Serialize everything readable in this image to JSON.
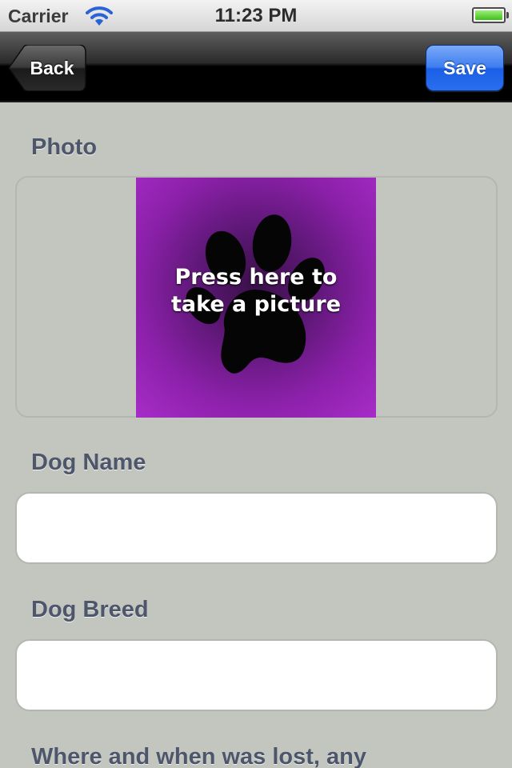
{
  "status_bar": {
    "carrier": "Carrier",
    "time": "11:23 PM",
    "icons": [
      "wifi-icon",
      "battery-icon"
    ]
  },
  "nav_bar": {
    "back_label": "Back",
    "save_label": "Save"
  },
  "form": {
    "photo_label": "Photo",
    "photo_caption_line1": "Press here to",
    "photo_caption_line2": "take a picture",
    "photo_icon": "paw-icon",
    "dog_name_label": "Dog Name",
    "dog_name_value": "",
    "dog_breed_label": "Dog Breed",
    "dog_breed_value": "",
    "lost_info_label": "Where and when was lost, any"
  },
  "colors": {
    "background": "#c3c6be",
    "label_text": "#4e566b",
    "save_button": "#2a6ef0",
    "photo_purple": "#a82cc9"
  }
}
